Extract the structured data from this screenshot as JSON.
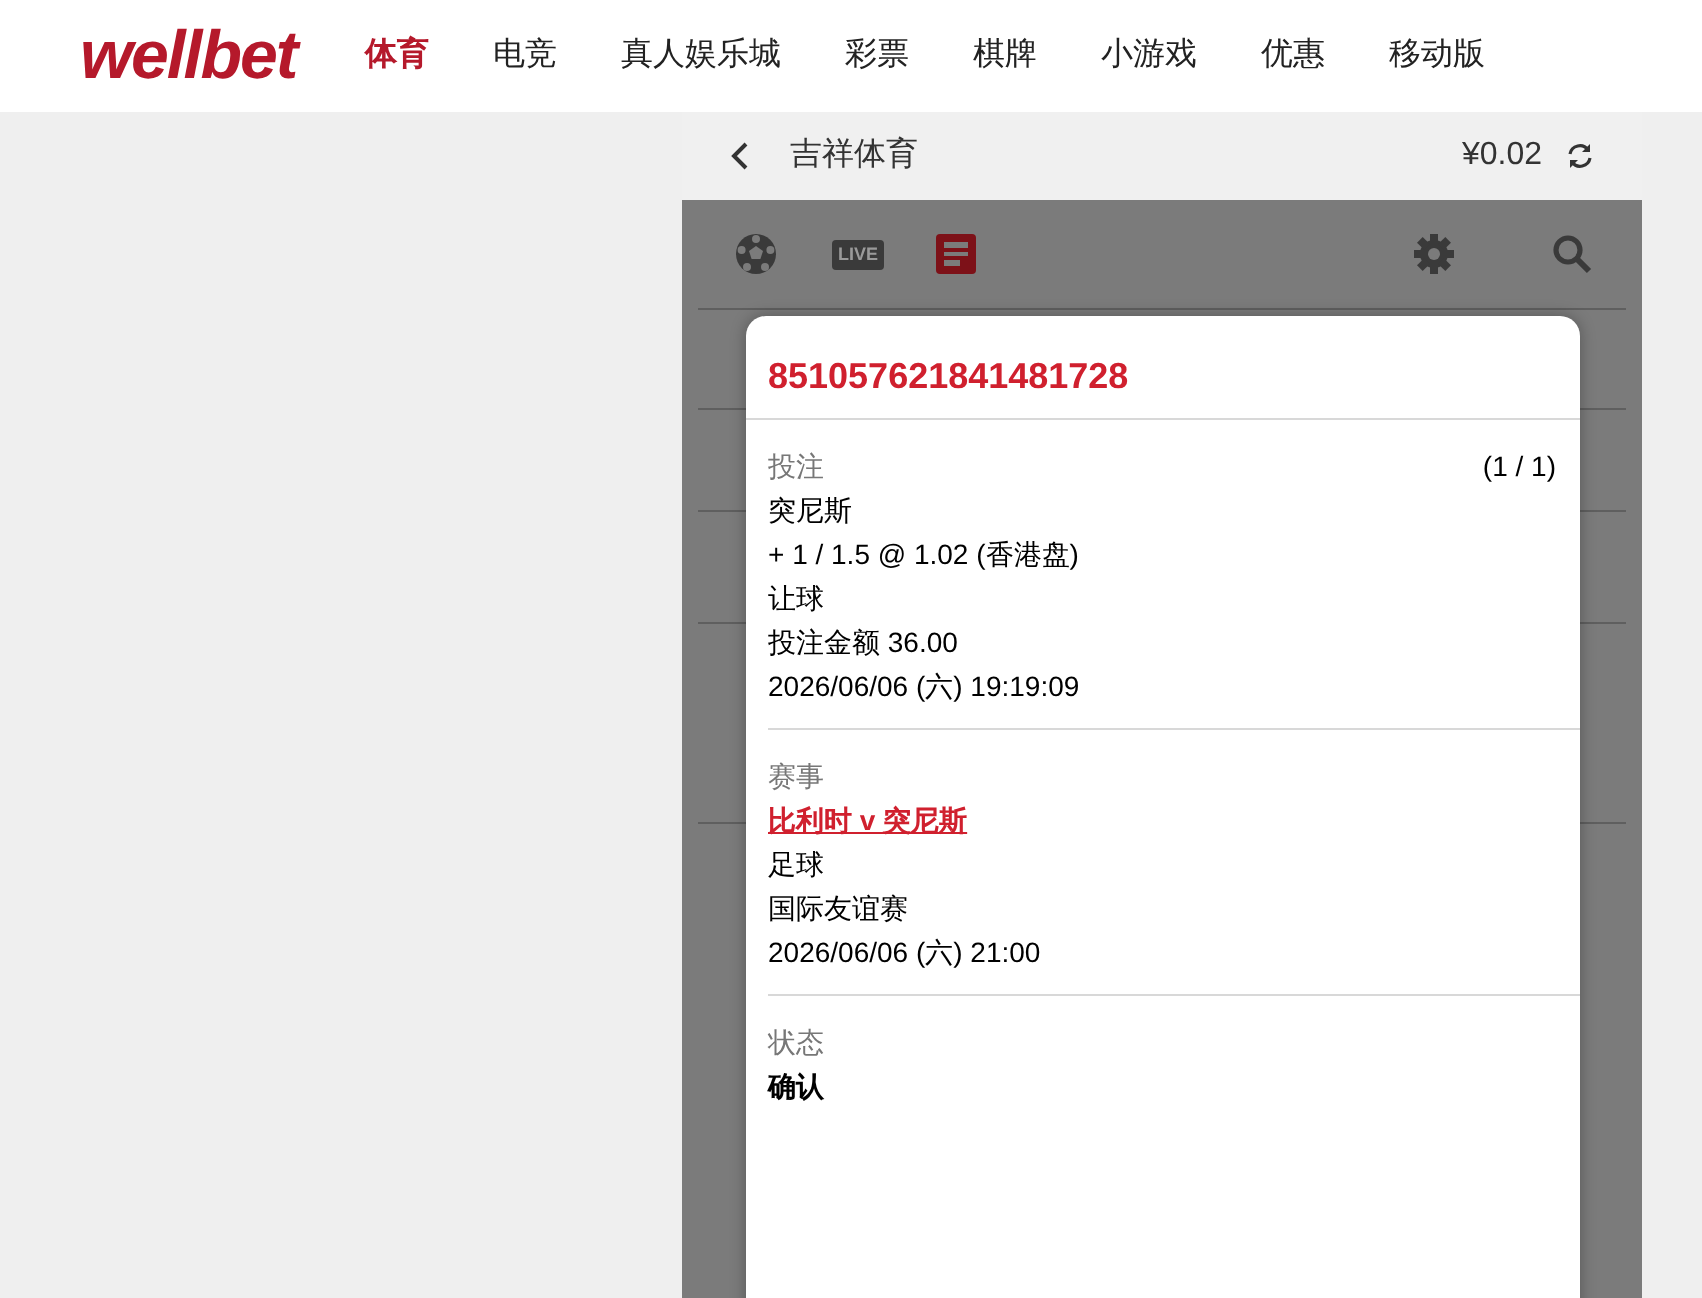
{
  "brand": "wellbet",
  "nav": [
    {
      "label": "体育",
      "selected": true
    },
    {
      "label": "电竞",
      "selected": false
    },
    {
      "label": "真人娱乐城",
      "selected": false
    },
    {
      "label": "彩票",
      "selected": false
    },
    {
      "label": "棋牌",
      "selected": false
    },
    {
      "label": "小游戏",
      "selected": false
    },
    {
      "label": "优惠",
      "selected": false
    },
    {
      "label": "移动版",
      "selected": false
    }
  ],
  "panel": {
    "title": "吉祥体育",
    "balance": "¥0.02"
  },
  "toolbar": [
    {
      "kind": "sport",
      "selected": false
    },
    {
      "kind": "live",
      "label": "LIVE",
      "selected": false
    },
    {
      "kind": "bets",
      "selected": true
    }
  ],
  "bet": {
    "id": "851057621841481728",
    "sections": [
      {
        "label": "投注",
        "counter": "(1 / 1)",
        "lines": [
          {
            "kind": "text",
            "text": "突尼斯"
          },
          {
            "kind": "text",
            "text": "+ 1 / 1.5 @ 1.02 (香港盘)"
          },
          {
            "kind": "text",
            "text": "让球"
          },
          {
            "kind": "text",
            "text": "投注金额 36.00"
          },
          {
            "kind": "text",
            "text": "2026/06/06 (六) 19:19:09"
          }
        ]
      },
      {
        "label": "赛事",
        "lines": [
          {
            "kind": "link",
            "text": "比利时 v 突尼斯"
          },
          {
            "kind": "text",
            "text": "足球"
          },
          {
            "kind": "text",
            "text": "国际友谊赛"
          },
          {
            "kind": "text",
            "text": "2026/06/06 (六) 21:00"
          }
        ]
      },
      {
        "label": "状态",
        "lines": [
          {
            "kind": "strong",
            "text": "确认"
          }
        ]
      }
    ]
  }
}
